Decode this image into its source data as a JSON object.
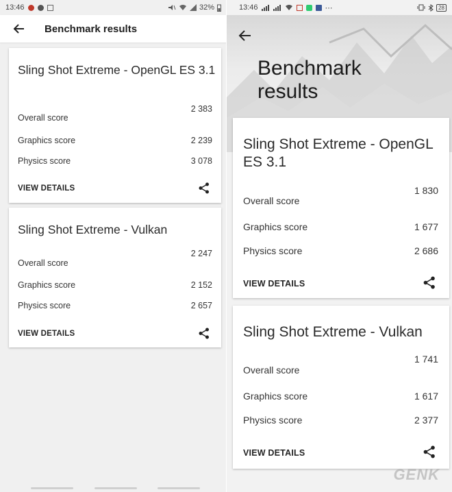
{
  "left": {
    "status": {
      "time": "13:46",
      "battery": "32%"
    },
    "appbar": {
      "title": "Benchmark results"
    },
    "cards": [
      {
        "title": "Sling Shot Extreme - OpenGL ES 3.1",
        "overall_label": "Overall score",
        "overall_value": "2 383",
        "graphics_label": "Graphics score",
        "graphics_value": "2 239",
        "physics_label": "Physics score",
        "physics_value": "3 078",
        "details": "VIEW DETAILS"
      },
      {
        "title": "Sling Shot Extreme - Vulkan",
        "overall_label": "Overall score",
        "overall_value": "2 247",
        "graphics_label": "Graphics score",
        "graphics_value": "2 152",
        "physics_label": "Physics score",
        "physics_value": "2 657",
        "details": "VIEW DETAILS"
      }
    ]
  },
  "right": {
    "status": {
      "time": "13:46",
      "battery": "28"
    },
    "hero": {
      "title_line1": "Benchmark",
      "title_line2": "results"
    },
    "cards": [
      {
        "title": "Sling Shot Extreme - OpenGL ES 3.1",
        "overall_label": "Overall score",
        "overall_value": "1 830",
        "graphics_label": "Graphics score",
        "graphics_value": "1 677",
        "physics_label": "Physics score",
        "physics_value": "2 686",
        "details": "VIEW DETAILS"
      },
      {
        "title": "Sling Shot Extreme - Vulkan",
        "overall_label": "Overall score",
        "overall_value": "1 741",
        "graphics_label": "Graphics score",
        "graphics_value": "1 617",
        "physics_label": "Physics score",
        "physics_value": "2 377",
        "details": "VIEW DETAILS"
      }
    ]
  },
  "watermark": "GENK",
  "colors": {
    "score_orange": "#f07e26"
  },
  "icons": [
    "back-arrow-icon",
    "share-icon",
    "wifi-icon",
    "signal-icon",
    "battery-icon"
  ]
}
